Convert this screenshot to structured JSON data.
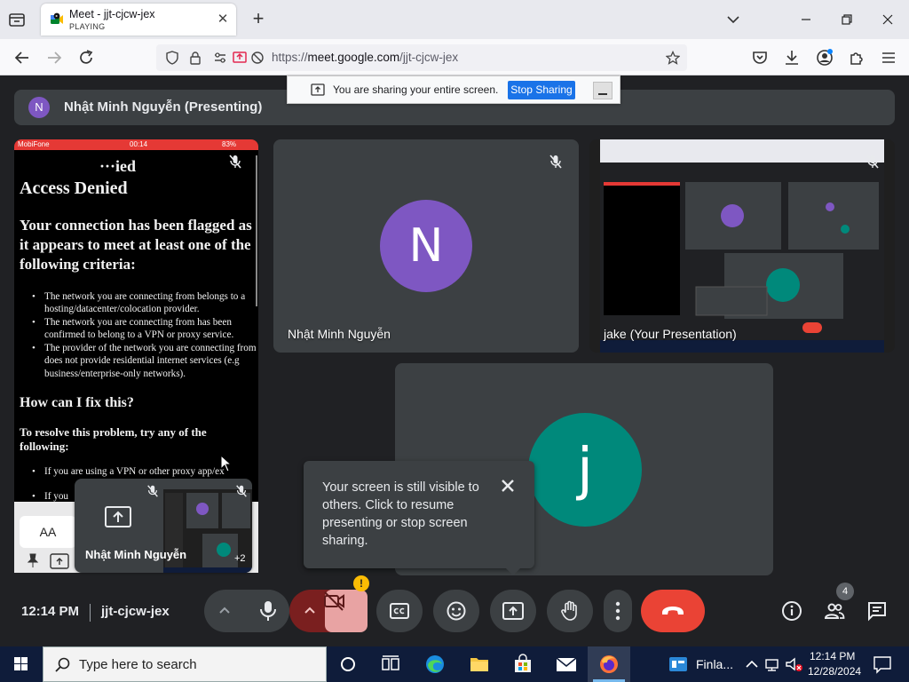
{
  "browser": {
    "tab_title": "Meet - jjt-cjcw-jex",
    "tab_status": "PLAYING",
    "tab_close": "✕",
    "new_tab": "+",
    "url_host": "meet.google.com",
    "url_prefix": "https://",
    "url_path": "/jjt-cjcw-jex"
  },
  "meet": {
    "presenter_initial": "N",
    "presenter_label": "Nhật Minh Nguyễn (Presenting)",
    "share_banner_text": "You are sharing your entire screen.",
    "stop_sharing_label": "Stop Sharing",
    "tiles": [
      {
        "name": "Nhật Minh Nguyễn",
        "initial": "N",
        "color": "#7e57c2"
      },
      {
        "name": "jake (Your Presentation)"
      },
      {
        "initial": "j",
        "color": "#00897b"
      }
    ],
    "pip_name": "Nhật Minh Nguyễn",
    "pip_count": "+2",
    "toast_text": "Your screen is still visible to others. Click to resume presenting or stop screen sharing.",
    "time": "12:14 PM",
    "meeting_code": "jjt-cjcw-jex",
    "people_count": "4",
    "end_call_color": "#ea4335",
    "camera_off_color": "#e8a3a3"
  },
  "phone": {
    "carrier": "MobiFone",
    "clock": "00:14",
    "battery": "83%",
    "heading_partial": "···ied",
    "heading": "Access Denied",
    "lead": "Your connection has been flagged as it appears to meet at least one of the following criteria:",
    "bullets": [
      "The network you are connecting from belongs to a hosting/datacenter/colocation provider.",
      "The network you are connecting from has been confirmed to belong to a VPN or proxy service.",
      "The provider of the network you are connecting from does not provide residential internet services (e.g business/enterprise-only networks)."
    ],
    "fix_heading": "How can I fix this?",
    "fix_lead": "To resolve this problem, try any of the following:",
    "fix_bullets": [
      "If you are using a VPN or other proxy app/ex",
      "If you"
    ],
    "aa_label": "AA"
  },
  "taskbar": {
    "search_placeholder": "Type here to search",
    "app_label": "Finla...",
    "clock_time": "12:14 PM",
    "clock_date": "12/28/2024"
  }
}
